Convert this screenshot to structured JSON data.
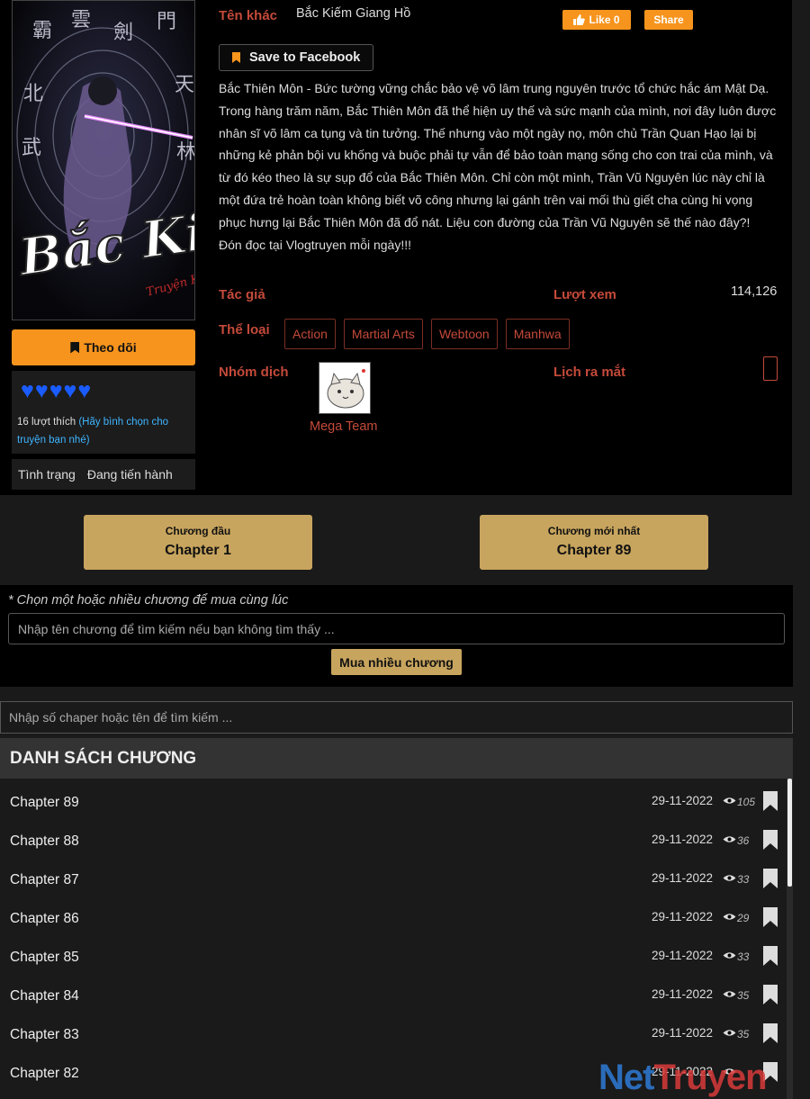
{
  "colors": {
    "accent_orange": "#f7941d",
    "gold_button": "#c8a55e",
    "label_red": "#c44a3a",
    "heart_blue": "#1a5cff",
    "link_blue": "#3fb5ff"
  },
  "cover": {
    "title_art": "Bắc Kiếm",
    "subtitle_art": "Truyện Kỹ"
  },
  "sidebar": {
    "follow_label": "Theo dõi",
    "hearts": 5,
    "likes_count": "16 lượt thích",
    "likes_cta": "(Hãy bình chọn cho truyện bạn nhé)",
    "status_label": "Tình trạng",
    "status_value": "Đang tiến hành"
  },
  "info": {
    "alt_name_label": "Tên khác",
    "alt_name_value": "Bắc Kiếm Giang Hồ",
    "fb_like_label": "Like 0",
    "fb_share_label": "Share",
    "save_facebook_label": "Save to Facebook",
    "description": "Bắc Thiên Môn - Bức tường vững chắc bảo vệ võ lâm trung nguyên trước tổ chức hắc ám Mật Dạ. Trong hàng trăm năm, Bắc Thiên Môn đã thể hiện uy thế và sức mạnh của mình, nơi đây luôn được nhân sĩ võ lâm ca tụng và tin tưởng. Thế nhưng vào một ngày nọ, môn chủ Trần Quan Hạo lại bị những kẻ phản bội vu khống và buộc phải tự vẫn để bảo toàn mạng sống cho con trai của mình, và từ đó kéo theo là sự sụp đổ của Bắc Thiên Môn. Chỉ còn một mình, Trần Vũ Nguyên lúc này chỉ là một đứa trẻ hoàn toàn không biết võ công nhưng lại gánh trên vai mối thù giết cha cùng hi vọng phục hưng lại Bắc Thiên Môn đã đổ nát. Liệu con đường của Trần Vũ Nguyên sẽ thế nào đây?!",
    "read_at": "Đón đọc tại Vlogtruyen mỗi ngày!!!",
    "author_label": "Tác giả",
    "views_label": "Lượt xem",
    "views_value": "114,126",
    "genre_label": "Thể loại",
    "genres": [
      "Action",
      "Martial Arts",
      "Webtoon",
      "Manhwa"
    ],
    "translator_label": "Nhóm dịch",
    "translator_name": "Mega Team",
    "release_label": "Lịch ra mắt"
  },
  "nav": {
    "first_small": "Chương đầu",
    "first_big": "Chapter 1",
    "latest_small": "Chương mới nhất",
    "latest_big": "Chapter 89"
  },
  "buy": {
    "note": "* Chọn một hoặc nhiều chương để mua cùng lúc",
    "placeholder": "Nhập tên chương để tìm kiếm nếu bạn không tìm thấy ...",
    "button_label": "Mua nhiều chương"
  },
  "search": {
    "placeholder": "Nhập số chaper hoặc tên để tìm kiếm ..."
  },
  "chapter_list": {
    "title": "DANH SÁCH CHƯƠNG",
    "chapters": [
      {
        "name": "Chapter 89",
        "date": "29-11-2022",
        "views": "105"
      },
      {
        "name": "Chapter 88",
        "date": "29-11-2022",
        "views": "36"
      },
      {
        "name": "Chapter 87",
        "date": "29-11-2022",
        "views": "33"
      },
      {
        "name": "Chapter 86",
        "date": "29-11-2022",
        "views": "29"
      },
      {
        "name": "Chapter 85",
        "date": "29-11-2022",
        "views": "33"
      },
      {
        "name": "Chapter 84",
        "date": "29-11-2022",
        "views": "35"
      },
      {
        "name": "Chapter 83",
        "date": "29-11-2022",
        "views": "35"
      },
      {
        "name": "Chapter 82",
        "date": "29-11-2022",
        "views": ""
      }
    ]
  },
  "watermark": {
    "part1": "Net",
    "part2": "Truyen"
  }
}
